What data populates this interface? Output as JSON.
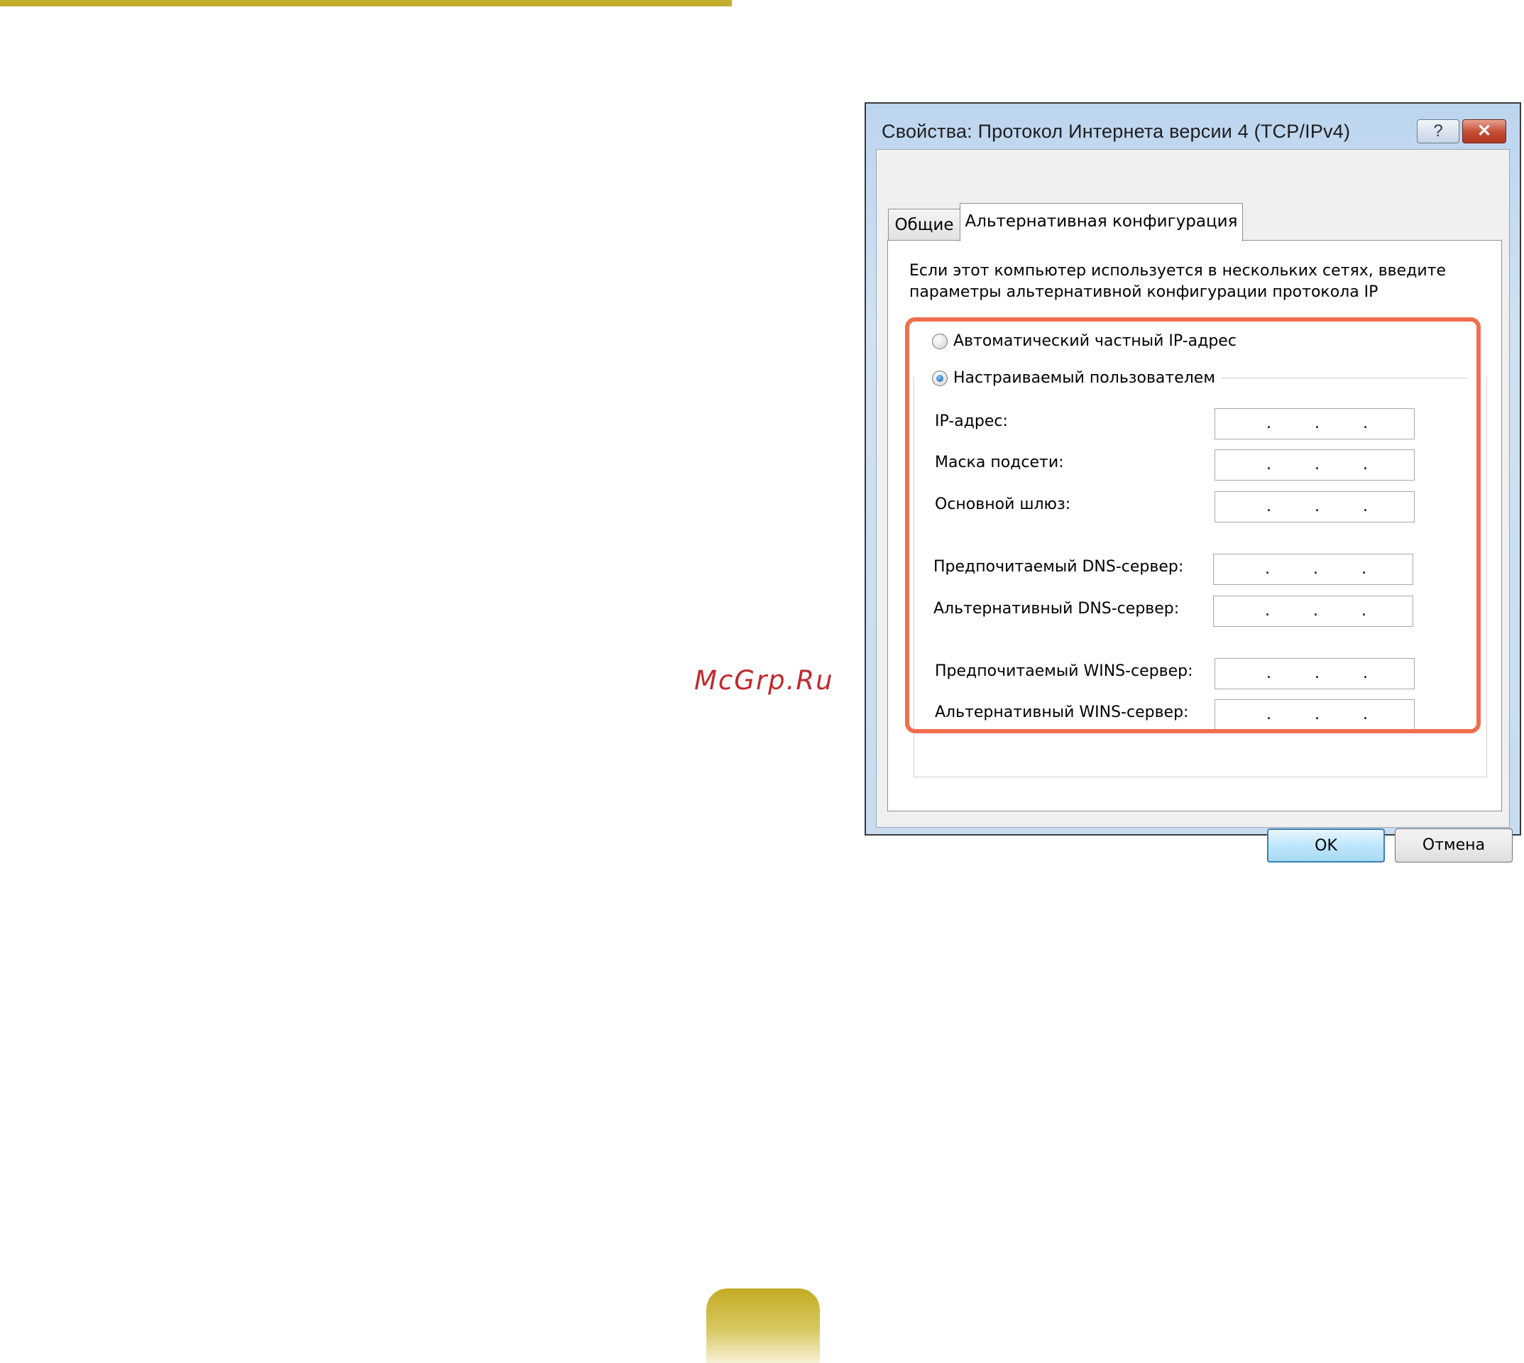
{
  "watermark": "McGrp.Ru",
  "dialog": {
    "title": "Свойства: Протокол Интернета версии 4 (TCP/IPv4)",
    "help_button": "?",
    "close_button": "✕",
    "tabs": [
      {
        "label": "Общие",
        "active": false
      },
      {
        "label": "Альтернативная конфигурация",
        "active": true
      }
    ],
    "description_line1": "Если этот компьютер используется в нескольких сетях, введите",
    "description_line2": "параметры альтернативной конфигурации протокола IP",
    "radio_auto": {
      "label": "Автоматический частный IP-адрес",
      "checked": false
    },
    "radio_user": {
      "label": "Настраиваемый пользователем",
      "checked": true
    },
    "fields": [
      {
        "label": "IP-адрес:",
        "value": " .  .  ."
      },
      {
        "label": "Маска подсети:",
        "value": " .  .  ."
      },
      {
        "label": "Основной шлюз:",
        "value": " .  .  ."
      },
      {
        "label": "Предпочитаемый DNS-сервер:",
        "value": " .  .  ."
      },
      {
        "label": "Альтернативный DNS-сервер:",
        "value": " .  .  ."
      },
      {
        "label": "Предпочитаемый WINS-сервер:",
        "value": " .  .  ."
      },
      {
        "label": "Альтернативный WINS-сервер:",
        "value": " .  .  ."
      }
    ],
    "ok_button": "OK",
    "cancel_button": "Отмена"
  },
  "colors": {
    "highlight": "#ef6f4e",
    "accent_gold": "#c2ad2e",
    "watermark": "#c0292f"
  }
}
